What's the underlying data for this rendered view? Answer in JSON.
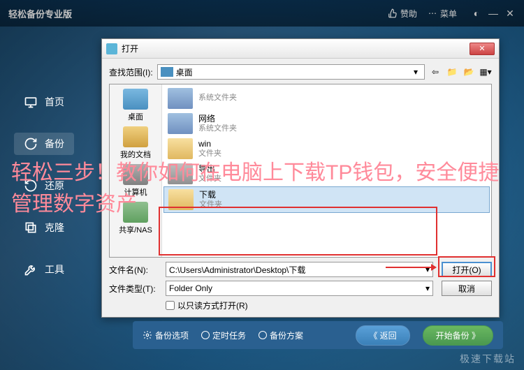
{
  "app": {
    "title": "轻松备份专业版",
    "sponsor": "赞助",
    "menu": "菜单"
  },
  "sidebar": {
    "items": [
      {
        "label": "首页"
      },
      {
        "label": "备份"
      },
      {
        "label": "还原"
      },
      {
        "label": "克隆"
      },
      {
        "label": "工具"
      }
    ]
  },
  "dialog": {
    "title": "打开",
    "look_in_label": "查找范围(I):",
    "look_in_value": "桌面",
    "places": [
      {
        "label": "桌面"
      },
      {
        "label": "我的文档"
      },
      {
        "label": "计算机"
      },
      {
        "label": "共享/NAS"
      }
    ],
    "files": [
      {
        "name": "",
        "sub": "系统文件夹",
        "icon": "sys"
      },
      {
        "name": "网络",
        "sub": "系统文件夹",
        "icon": "sys"
      },
      {
        "name": "win",
        "sub": "文件夹",
        "icon": "folder"
      },
      {
        "name": "导出",
        "sub": "文件夹",
        "icon": "rec"
      },
      {
        "name": "下载",
        "sub": "文件夹",
        "icon": "folder",
        "selected": true
      }
    ],
    "filename_label": "文件名(N):",
    "filename_value": "C:\\Users\\Administrator\\Desktop\\下载",
    "filetype_label": "文件类型(T):",
    "filetype_value": "Folder Only",
    "readonly_label": "以只读方式打开(R)",
    "open_btn": "打开(O)",
    "cancel_btn": "取消"
  },
  "bottom_bar": {
    "options": "备份选项",
    "schedule": "定时任务",
    "scheme": "备份方案",
    "back": "《 返回",
    "start": "开始备份 》"
  },
  "overlay": "轻松三步！教你如何在电脑上下载TP钱包，安全便捷管理数字资产",
  "watermark": "极速下载站"
}
